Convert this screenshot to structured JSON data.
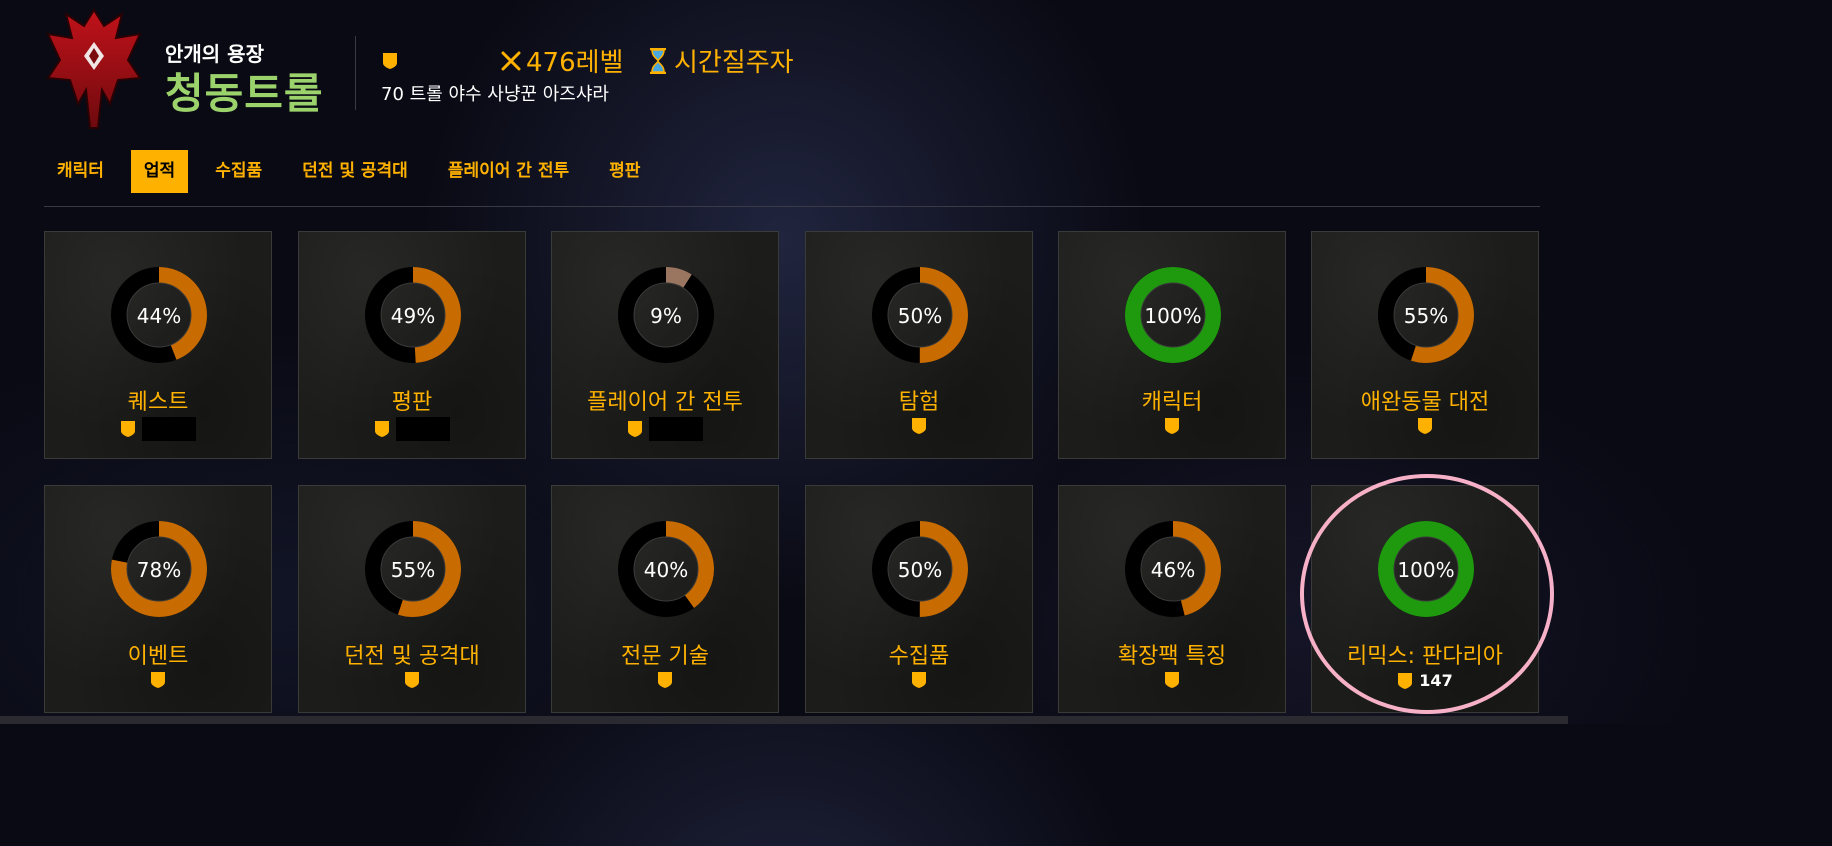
{
  "header": {
    "title": "안개의 용장",
    "name": "청동트롤",
    "item_level": "476레벨",
    "covenant": "시간질주자",
    "info": "70 트롤 야수 사냥꾼 아즈샤라"
  },
  "nav": {
    "tabs": [
      "캐릭터",
      "업적",
      "수집품",
      "던전 및 공격대",
      "플레이어 간 전투",
      "평판"
    ],
    "active": "업적"
  },
  "categories": [
    {
      "label": "퀘스트",
      "percent_text": "44%",
      "percent": 44,
      "color": "#c86b00",
      "redacted": true,
      "count": ""
    },
    {
      "label": "평판",
      "percent_text": "49%",
      "percent": 49,
      "color": "#c86b00",
      "redacted": true,
      "count": ""
    },
    {
      "label": "플레이어 간 전투",
      "percent_text": "9%",
      "percent": 9,
      "color": "#9a7560",
      "redacted": true,
      "count": ""
    },
    {
      "label": "탐험",
      "percent_text": "50%",
      "percent": 50,
      "color": "#c86b00",
      "redacted": false,
      "count": ""
    },
    {
      "label": "캐릭터",
      "percent_text": "100%",
      "percent": 100,
      "color": "#1f9a0f",
      "redacted": false,
      "count": ""
    },
    {
      "label": "애완동물 대전",
      "percent_text": "55%",
      "percent": 55,
      "color": "#c86b00",
      "redacted": false,
      "count": ""
    },
    {
      "label": "이벤트",
      "percent_text": "78%",
      "percent": 78,
      "color": "#c86b00",
      "redacted": false,
      "count": ""
    },
    {
      "label": "던전 및 공격대",
      "percent_text": "55%",
      "percent": 55,
      "color": "#c86b00",
      "redacted": false,
      "count": ""
    },
    {
      "label": "전문 기술",
      "percent_text": "40%",
      "percent": 40,
      "color": "#c86b00",
      "redacted": false,
      "count": ""
    },
    {
      "label": "수집품",
      "percent_text": "50%",
      "percent": 50,
      "color": "#c86b00",
      "redacted": false,
      "count": ""
    },
    {
      "label": "확장팩 특징",
      "percent_text": "46%",
      "percent": 46,
      "color": "#c86b00",
      "redacted": false,
      "count": ""
    },
    {
      "label": "리믹스: 판다리아",
      "percent_text": "100%",
      "percent": 100,
      "color": "#1f9a0f",
      "redacted": false,
      "count": "147"
    }
  ],
  "colors": {
    "accent": "#ffb100",
    "name_green": "#9bd26b",
    "progress_orange": "#c86b00",
    "progress_green": "#1f9a0f",
    "highlight_pink": "#f6b1c8"
  },
  "icons": {
    "faction": "horde-emblem-icon",
    "achievement": "achievement-shield-icon",
    "item_level": "crossed-swords-icon",
    "covenant": "hourglass-icon"
  }
}
